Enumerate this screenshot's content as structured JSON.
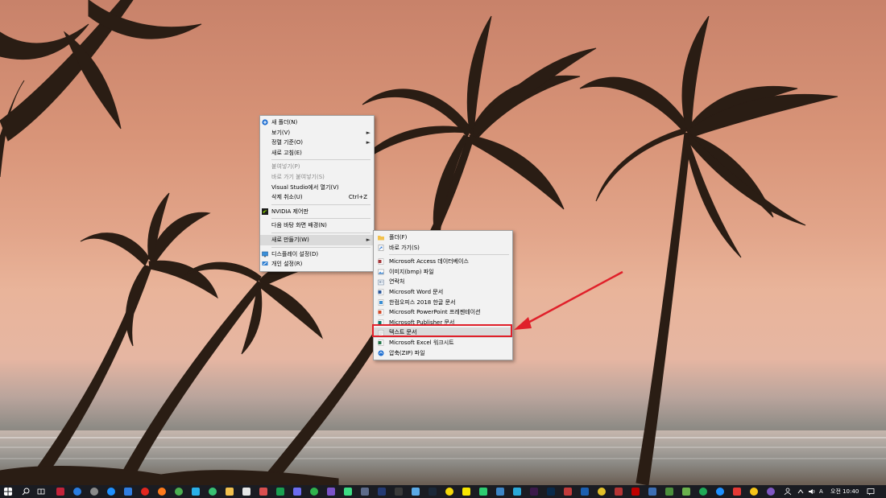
{
  "context_menu": {
    "items": [
      {
        "label": "새 폴더(N)",
        "icon": "folder-plus-icon",
        "disabled": false
      },
      {
        "label": "보기(V)",
        "submenu": true
      },
      {
        "label": "정렬 기준(O)",
        "submenu": true
      },
      {
        "label": "새로 고침(E)"
      },
      {
        "label": "붙여넣기(P)",
        "disabled": true
      },
      {
        "label": "바로 가기 붙여넣기(S)",
        "disabled": true
      },
      {
        "label": "Visual Studio에서 열기(V)"
      },
      {
        "label": "삭제 취소(U)",
        "shortcut": "Ctrl+Z"
      },
      {
        "label": "NVIDIA 제어판",
        "icon": "nvidia-icon"
      },
      {
        "label": "다음 바탕 화면 배경(N)"
      },
      {
        "label": "새로 만들기(W)",
        "submenu": true,
        "highlighted": true
      },
      {
        "label": "디스플레이 설정(D)",
        "icon": "display-icon"
      },
      {
        "label": "개인 설정(R)",
        "icon": "personalize-icon"
      }
    ]
  },
  "new_submenu": {
    "items": [
      {
        "label": "폴더(F)",
        "icon": "folder-icon"
      },
      {
        "label": "바로 가기(S)",
        "icon": "shortcut-icon"
      },
      {
        "label": "Microsoft Access 데이터베이스",
        "icon": "access-icon"
      },
      {
        "label": "이미지(bmp) 파일",
        "icon": "bitmap-icon"
      },
      {
        "label": "연락처",
        "icon": "contact-icon"
      },
      {
        "label": "Microsoft Word 문서",
        "icon": "word-icon"
      },
      {
        "label": "한컴오피스 2018 한글 문서",
        "icon": "hwp-icon"
      },
      {
        "label": "Microsoft PowerPoint 프레젠테이션",
        "icon": "powerpoint-icon"
      },
      {
        "label": "Microsoft Publisher 문서",
        "icon": "publisher-icon"
      },
      {
        "label": "텍스트 문서",
        "icon": "text-document-icon",
        "highlighted": true
      },
      {
        "label": "Microsoft Excel 워크시트",
        "icon": "excel-icon"
      },
      {
        "label": "압축(ZIP) 파일",
        "icon": "zip-icon"
      }
    ]
  },
  "taskbar": {
    "clock": "오전 10:40",
    "ime": "A",
    "accent_color": "#e0202a"
  }
}
